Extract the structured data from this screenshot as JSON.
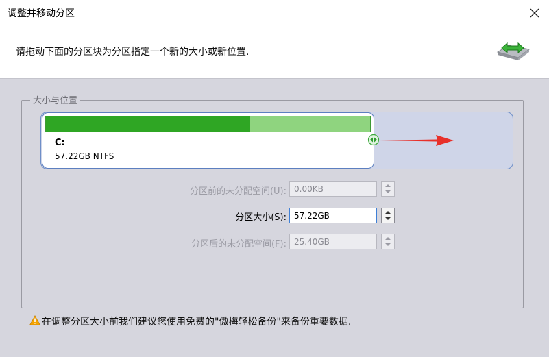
{
  "window": {
    "title": "调整并移动分区"
  },
  "header": {
    "instruction": "请拖动下面的分区块为分区指定一个新的大小或新位置."
  },
  "size_position": {
    "legend": "大小与位置",
    "partition": {
      "letter": "C:",
      "info": "57.22GB NTFS",
      "used_fraction": 0.63
    },
    "fields": [
      {
        "label": "分区前的未分配空间(U):",
        "value": "0.00KB",
        "enabled": false
      },
      {
        "label": "分区大小(S):",
        "value": "57.22GB",
        "enabled": true
      },
      {
        "label": "分区后的未分配空间(F):",
        "value": "25.40GB",
        "enabled": false
      }
    ]
  },
  "footer": {
    "warning": "在调整分区大小前我们建议您使用免费的\"傲梅轻松备份\"来备份重要数据."
  },
  "colors": {
    "used": "#2fa624",
    "free": "#8fd47f",
    "arrow": "#e8302a",
    "warning": "#f5a300"
  }
}
